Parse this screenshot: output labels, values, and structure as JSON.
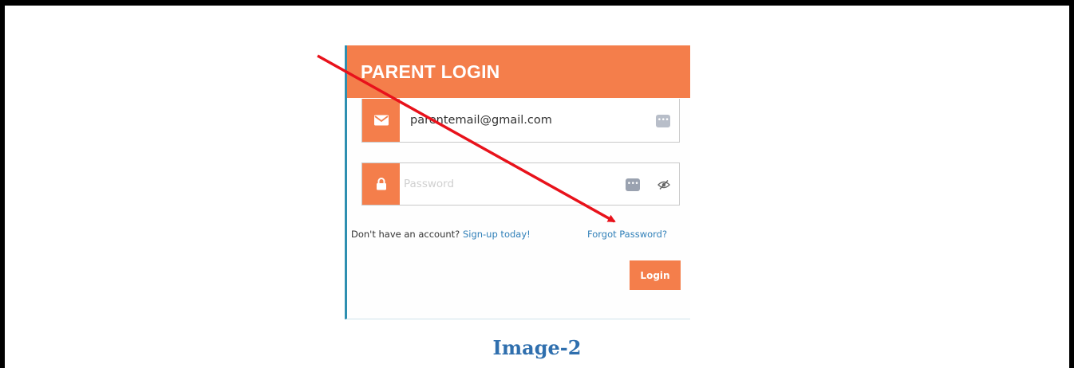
{
  "login_panel": {
    "title": "PARENT LOGIN",
    "email": {
      "value": "parentemail@gmail.com",
      "icon": "envelope-icon"
    },
    "password": {
      "placeholder": "Password",
      "icon": "lock-icon"
    },
    "no_account_text": "Don't have an account?",
    "signup_link": "Sign-up today!",
    "forgot_link": "Forgot Password?",
    "login_button": "Login"
  },
  "caption": "Image-2",
  "colors": {
    "accent": "#f47e4b",
    "link": "#2f7fb8",
    "arrow": "#e8121b",
    "caption": "#2f6fae"
  }
}
